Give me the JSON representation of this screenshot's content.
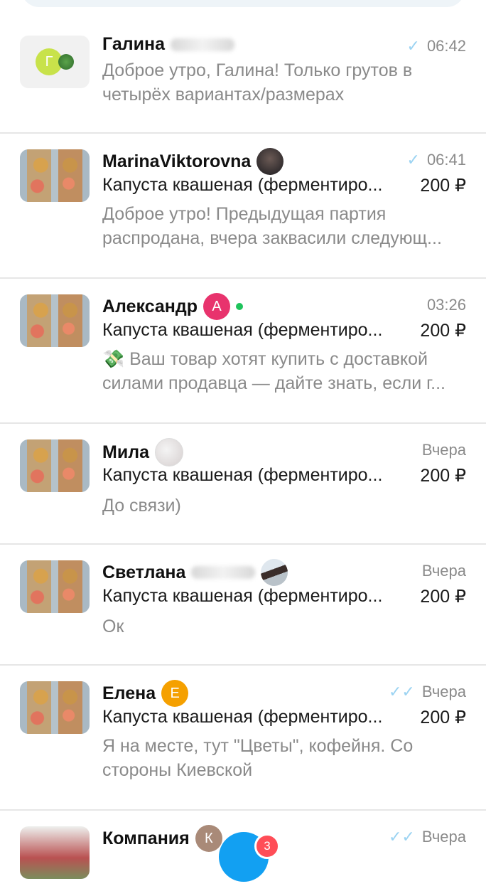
{
  "conversations": [
    {
      "name": "Галина",
      "avatar_letter": "Г",
      "avatar_color": "#c8e24a",
      "time": "06:42",
      "read_status": "sent",
      "preview": "Доброе утро, Галина! Только грутов в четырёх вариантах/размерах"
    },
    {
      "name": "MarinaViktorovna",
      "time": "06:41",
      "read_status": "sent",
      "ad_title": "Капуста квашеная (ферментиро...",
      "price": "200 ₽",
      "preview": "Доброе утро! Предыдущая партия распродана, вчера заквасили следующ..."
    },
    {
      "name": "Александр",
      "avatar_letter": "А",
      "avatar_color": "#e8336d",
      "online": true,
      "time": "03:26",
      "ad_title": "Капуста квашеная (ферментиро...",
      "price": "200 ₽",
      "preview": "💸 Ваш товар хотят купить с доставкой силами продавца — дайте знать, если г..."
    },
    {
      "name": "Мила",
      "time": "Вчера",
      "ad_title": "Капуста квашеная (ферментиро...",
      "price": "200 ₽",
      "preview": "До связи)"
    },
    {
      "name": "Светлана",
      "time": "Вчера",
      "ad_title": "Капуста квашеная (ферментиро...",
      "price": "200 ₽",
      "preview": "Ок"
    },
    {
      "name": "Елена",
      "avatar_letter": "Е",
      "avatar_color": "#f5a000",
      "time": "Вчера",
      "read_status": "read",
      "ad_title": "Капуста квашеная (ферментиро...",
      "price": "200 ₽",
      "preview": "Я на месте, тут \"Цветы\", кофейня. Со стороны Киевской"
    },
    {
      "name": "Компания",
      "avatar_letter": "К",
      "avatar_color": "#a98a78",
      "time": "Вчера",
      "read_status": "read"
    }
  ],
  "tabbar": {
    "messages_badge": "3",
    "accent_color": "#12a0f2"
  },
  "icons": {
    "sent": "check-icon",
    "read": "double-check-icon"
  }
}
